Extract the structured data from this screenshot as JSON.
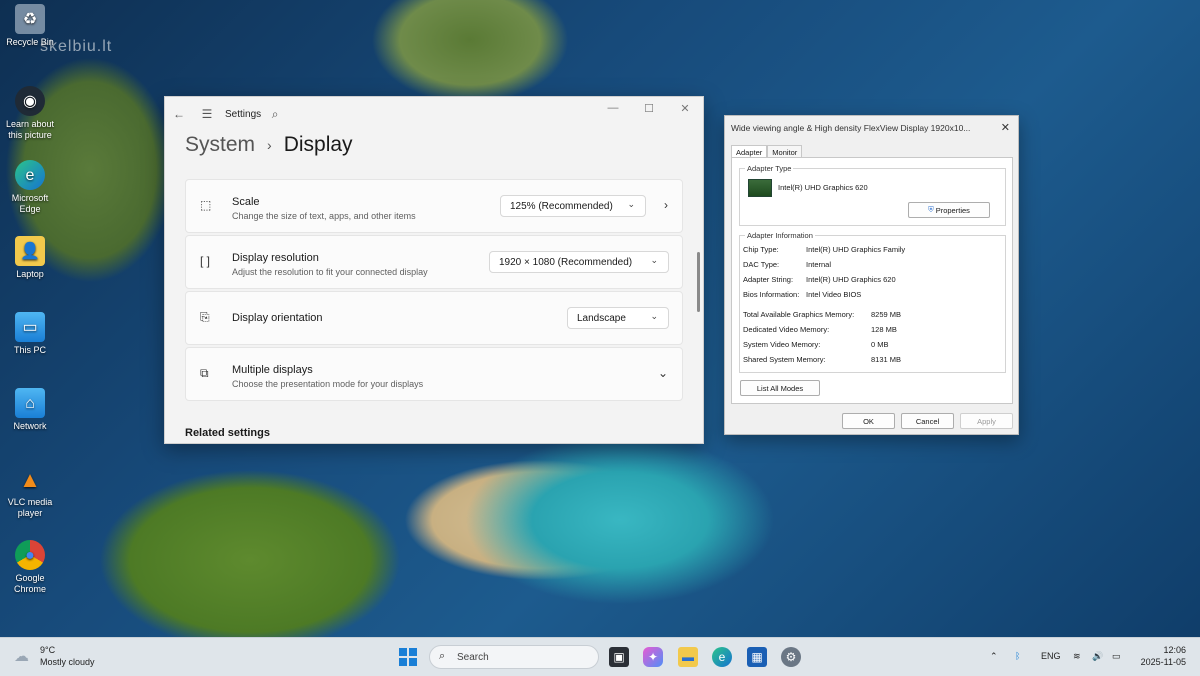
{
  "watermark": "skelbiu.lt",
  "desktop_icons": [
    {
      "label": "Recycle Bin",
      "icon": "recycle-bin-icon"
    },
    {
      "label": "Learn about this picture",
      "icon": "camera-icon"
    },
    {
      "label": "Microsoft Edge",
      "icon": "edge-icon"
    },
    {
      "label": "Laptop",
      "icon": "user-folder-icon"
    },
    {
      "label": "This PC",
      "icon": "monitor-icon"
    },
    {
      "label": "Network",
      "icon": "network-icon"
    },
    {
      "label": "VLC media player",
      "icon": "vlc-cone-icon"
    },
    {
      "label": "Google Chrome",
      "icon": "chrome-icon"
    }
  ],
  "settings": {
    "app_label": "Settings",
    "breadcrumb": {
      "parent": "System",
      "current": "Display"
    },
    "rows": [
      {
        "title": "Scale",
        "subtitle": "Change the size of text, apps, and other items",
        "value": "125% (Recommended)"
      },
      {
        "title": "Display resolution",
        "subtitle": "Adjust the resolution to fit your connected display",
        "value": "1920 × 1080 (Recommended)"
      },
      {
        "title": "Display orientation",
        "subtitle": "",
        "value": "Landscape"
      },
      {
        "title": "Multiple displays",
        "subtitle": "Choose the presentation mode for your displays",
        "value": ""
      }
    ],
    "related_heading": "Related settings"
  },
  "dialog": {
    "title": "Wide viewing angle & High density FlexView Display 1920x10...",
    "tabs": [
      "Adapter",
      "Monitor"
    ],
    "adapter_type_label": "Adapter Type",
    "adapter_name": "Intel(R) UHD Graphics 620",
    "properties_button": "Properties",
    "adapter_info_label": "Adapter Information",
    "info": [
      {
        "label": "Chip Type:",
        "value": "Intel(R) UHD Graphics Family"
      },
      {
        "label": "DAC Type:",
        "value": "Internal"
      },
      {
        "label": "Adapter String:",
        "value": "Intel(R) UHD Graphics 620"
      },
      {
        "label": "Bios Information:",
        "value": "Intel Video BIOS"
      }
    ],
    "memory": [
      {
        "label": "Total Available Graphics Memory:",
        "value": "8259 MB"
      },
      {
        "label": "Dedicated Video Memory:",
        "value": "128 MB"
      },
      {
        "label": "System Video Memory:",
        "value": "0 MB"
      },
      {
        "label": "Shared System Memory:",
        "value": "8131 MB"
      }
    ],
    "list_modes_button": "List All Modes",
    "ok_button": "OK",
    "cancel_button": "Cancel",
    "apply_button": "Apply"
  },
  "taskbar": {
    "weather_temp": "9°C",
    "weather_desc": "Mostly cloudy",
    "search_placeholder": "Search",
    "language": "ENG",
    "time": "12:06",
    "date": "2025-11-05"
  },
  "colors": {
    "accent": "#1a7fd6",
    "settings_bg": "#f3f3f3",
    "taskbar_bg": "#dfe5ea"
  }
}
